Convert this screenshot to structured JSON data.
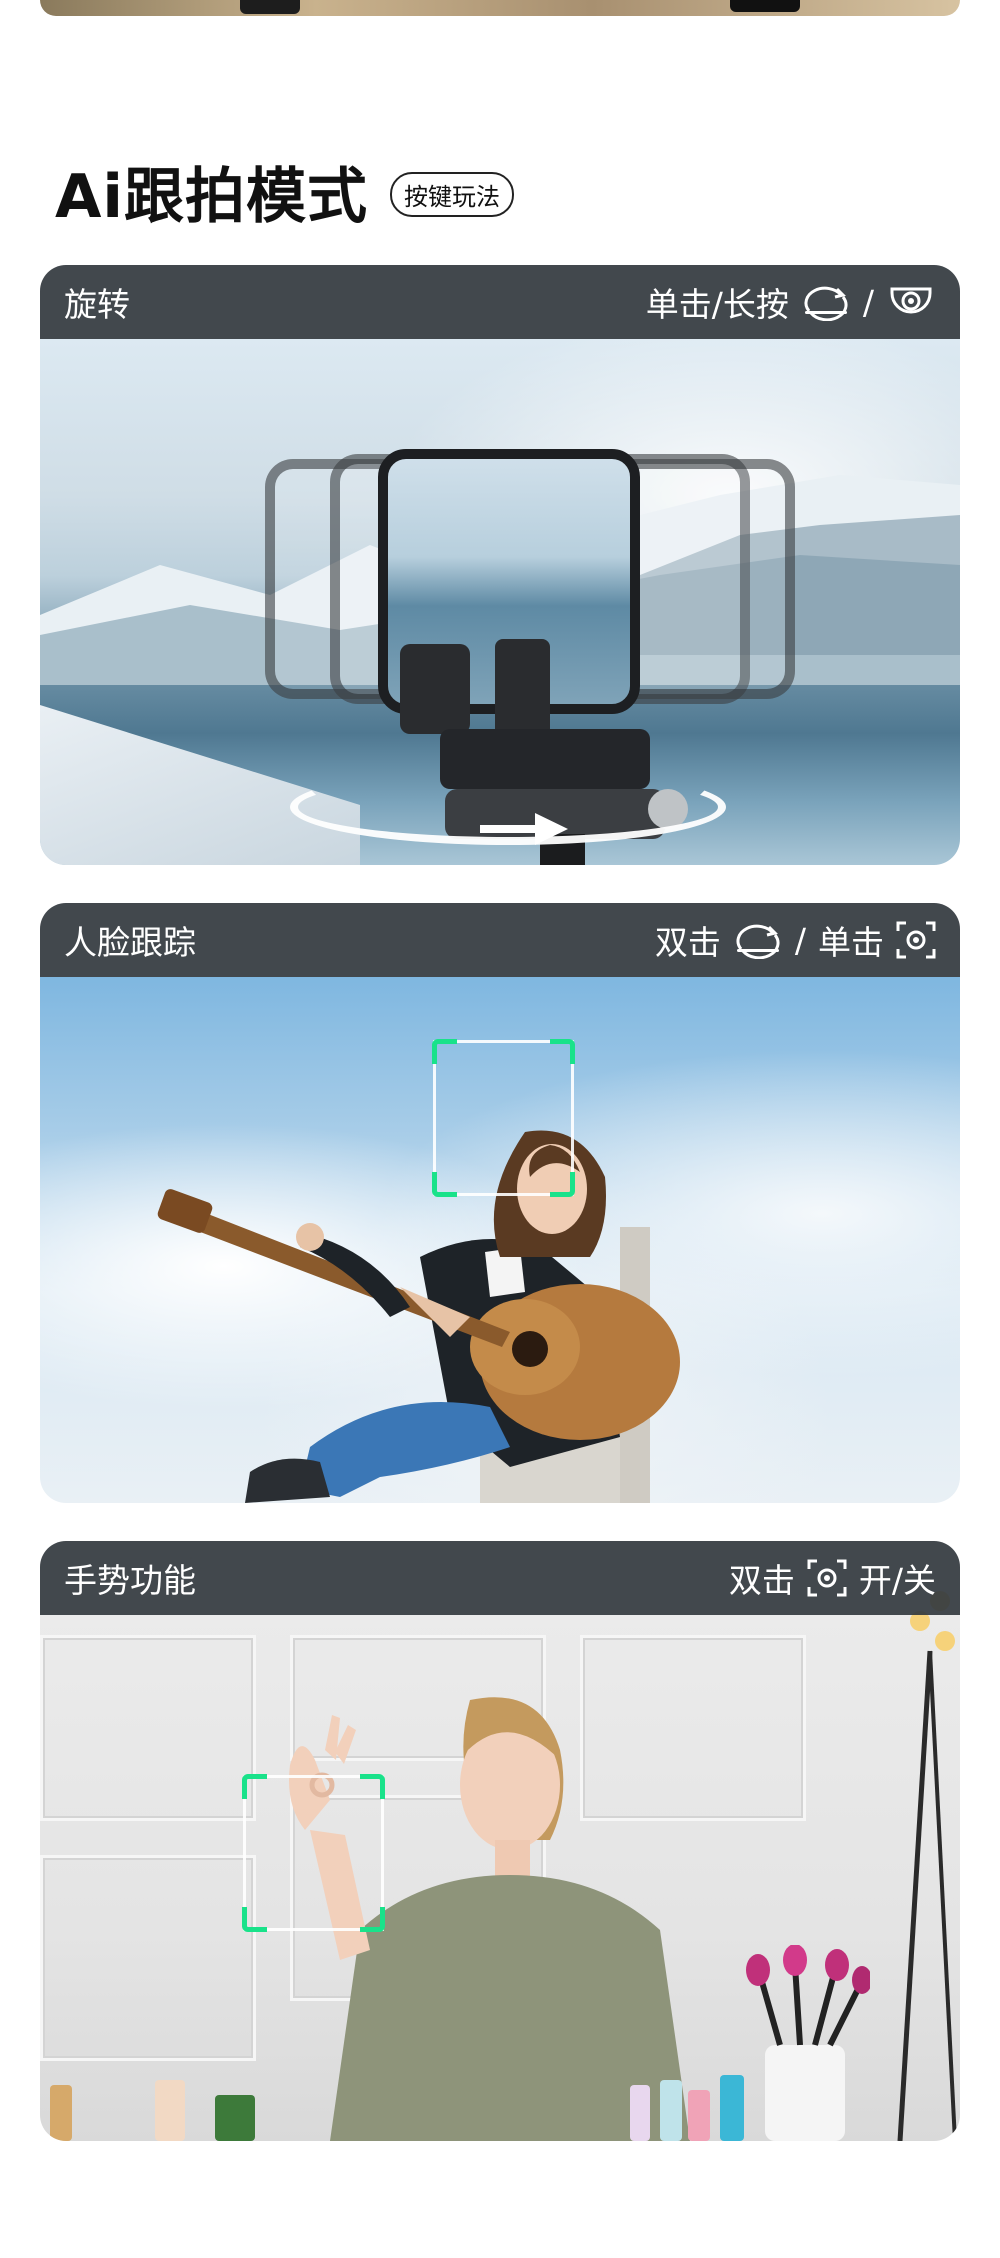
{
  "section": {
    "title": "Ai跟拍模式",
    "badge": "按键玩法"
  },
  "cards": [
    {
      "title": "旋转",
      "action": "单击/长按",
      "separator": "/",
      "icons": [
        "rotate-icon",
        "spiral-icon"
      ]
    },
    {
      "title": "人脸跟踪",
      "action_1": "双击",
      "separator": "/",
      "action_2": "单击",
      "icons": [
        "rotate-icon",
        "face-target-icon"
      ]
    },
    {
      "title": "手势功能",
      "action_1": "双击",
      "action_2": "开/关",
      "icons": [
        "face-target-icon"
      ]
    }
  ],
  "colors": {
    "header_bg": "#32383e",
    "focus_corner": "#19e28a"
  }
}
